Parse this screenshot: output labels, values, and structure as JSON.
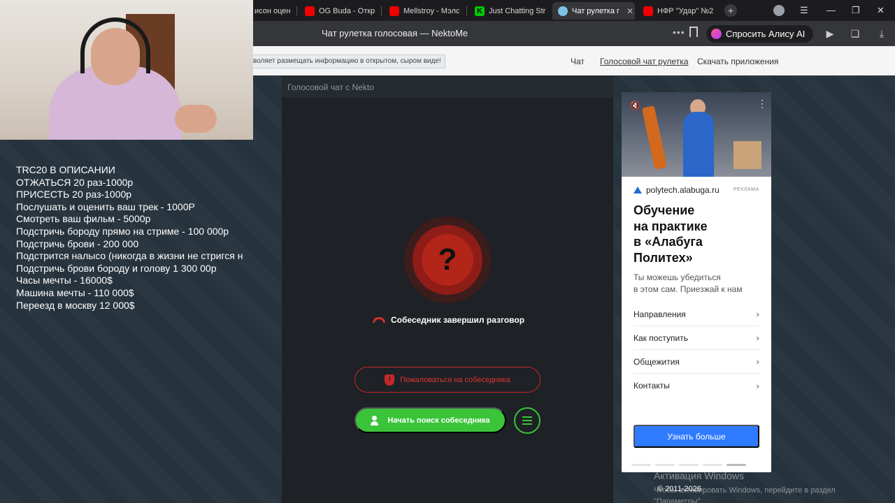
{
  "browser": {
    "tabs": [
      {
        "label": "исон оцен",
        "icon": "none"
      },
      {
        "label": "OG Buda - Откр",
        "icon": "youtube-icon"
      },
      {
        "label": "Mellstroy - Мэлс",
        "icon": "youtube-icon"
      },
      {
        "label": "Just Chatting Str",
        "icon": "kick-icon"
      },
      {
        "label": "Чат рулетка г",
        "icon": "nekto-icon",
        "active": true
      },
      {
        "label": "НФР \"Удар\" №2",
        "icon": "youtube-icon"
      }
    ],
    "page_title": "Чат рулетка голосовая — NektoMe",
    "alice_button": "Спросить Алису AI"
  },
  "site": {
    "notice": "воляет размещать информацию в открытом, сыром виде!",
    "nav": [
      "Чат",
      "Голосовой чат рулетка",
      "Скачать приложения"
    ]
  },
  "chat": {
    "header": "Голосовой чат с Nekto",
    "question_mark": "?",
    "status": "Собеседник завершил разговор",
    "report_button": "Пожаловаться на собеседника",
    "search_button": "Начать поиск собеседника"
  },
  "ad": {
    "domain": "polytech.alabuga.ru",
    "label": "РЕКЛАМА",
    "title_lines": [
      "Обучение",
      "на практике",
      "в «Алабуга",
      "Политех»"
    ],
    "subtitle_lines": [
      "Ты можешь убедиться",
      "в этом сам. Приезжай к нам"
    ],
    "links": [
      "Направления",
      "Как поступить",
      "Общежития",
      "Контакты"
    ],
    "cta": "Узнать больше"
  },
  "overlay": {
    "donation_lines": [
      "TRC20 В ОПИСАНИИ",
      "ОТЖАТЬСЯ 20 раз-1000р",
      "ПРИСЕСТЬ 20 раз-1000р",
      "Послушать и оценить ваш трек - 1000Р",
      "Смотреть ваш фильм - 5000р",
      "Подстричь бороду прямо на стриме - 100 000р",
      "Подстричь брови - 200 000",
      "Подстрится налысо (никогда в жизни не стригся н",
      "Подстричь брови бороду и голову 1 300 00р",
      "Часы мечты - 16000$",
      "Машина мечты - 110 000$",
      "Переезд в москву 12 000$"
    ]
  },
  "footer": {
    "copyright": "© 2011-2026",
    "windows_activation": "Активация Windows",
    "windows_activation_sub": "Чтобы активировать Windows, перейдите в раздел",
    "windows_activation_sub2": "\"Параметры\"."
  }
}
